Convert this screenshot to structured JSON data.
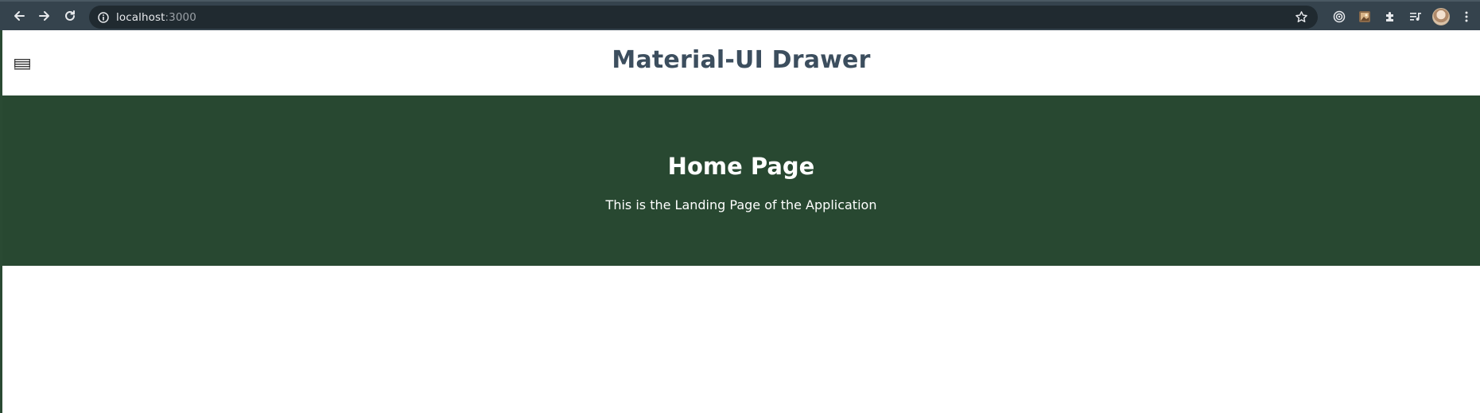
{
  "browser": {
    "url_host": "localhost",
    "url_port": ":3000",
    "icons": {
      "back": "arrow-left-icon",
      "forward": "arrow-right-icon",
      "reload": "reload-icon",
      "info": "info-icon",
      "bookmark": "star-icon",
      "extensions": [
        "target-icon",
        "photo-extension-icon",
        "puzzle-icon",
        "queue-icon",
        "avatar",
        "kebab-menu-icon"
      ]
    },
    "colors": {
      "chrome": "#35434d",
      "omnibox": "#202a30"
    }
  },
  "appbar": {
    "title": "Material-UI Drawer",
    "menu_icon": "hamburger-menu-icon",
    "title_color": "#3c4e5e"
  },
  "hero": {
    "heading": "Home Page",
    "subtitle": "This is the Landing Page of the Application",
    "background": "#284831"
  }
}
